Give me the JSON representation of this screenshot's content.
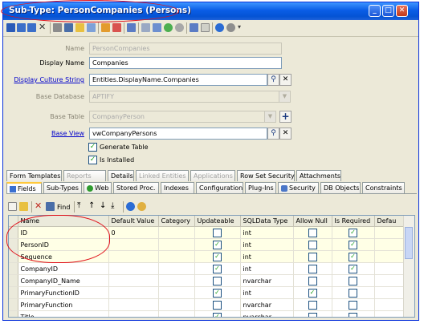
{
  "window": {
    "title": "Sub-Type: PersonCompanies (Persons)"
  },
  "colors": {
    "titlebar": "#0a5de6",
    "highlight_annotation": "#e0101a",
    "link": "#0000cc"
  },
  "form": {
    "name": {
      "label": "Name",
      "value": "PersonCompanies"
    },
    "display_name": {
      "label": "Display Name",
      "value": "Companies"
    },
    "display_culture_string": {
      "label": "Display Culture String",
      "value": "Entities.DisplayName.Companies"
    },
    "base_database": {
      "label": "Base Database",
      "value": "APTIFY"
    },
    "base_table": {
      "label": "Base Table",
      "value": "CompanyPerson"
    },
    "base_view": {
      "label": "Base View",
      "value": "vwCompanyPersons"
    },
    "generate_table": {
      "label": "Generate Table",
      "checked": true
    },
    "is_installed": {
      "label": "Is Installed",
      "checked": true
    }
  },
  "tabs_row1": [
    "Form Templates",
    "Reports",
    "Details",
    "Linked Entities",
    "Applications",
    "Row Set Security",
    "Attachments"
  ],
  "tabs_row2": [
    "Fields",
    "Sub-Types",
    "Web",
    "Stored Proc.",
    "Indexes",
    "Configuration",
    "Plug-Ins",
    "Security",
    "DB Objects",
    "Constraints"
  ],
  "grid_toolbar": {
    "find_label": "Find"
  },
  "grid": {
    "columns": [
      "Name",
      "Default Value",
      "Category",
      "Updateable",
      "SQLData Type",
      "Allow Null",
      "Is Required",
      "Defau"
    ],
    "rows": [
      {
        "name": "ID",
        "default": "0",
        "category": "",
        "updateable": false,
        "sqltype": "int",
        "allow_null": false,
        "required": true
      },
      {
        "name": "PersonID",
        "default": "",
        "category": "",
        "updateable": true,
        "sqltype": "int",
        "allow_null": false,
        "required": true
      },
      {
        "name": "Sequence",
        "default": "",
        "category": "",
        "updateable": true,
        "sqltype": "int",
        "allow_null": false,
        "required": true
      },
      {
        "name": "CompanyID",
        "default": "",
        "category": "",
        "updateable": true,
        "sqltype": "int",
        "allow_null": false,
        "required": true
      },
      {
        "name": "CompanyID_Name",
        "default": "",
        "category": "",
        "updateable": false,
        "sqltype": "nvarchar",
        "allow_null": false,
        "required": false
      },
      {
        "name": "PrimaryFunctionID",
        "default": "",
        "category": "",
        "updateable": true,
        "sqltype": "int",
        "allow_null": true,
        "required": false
      },
      {
        "name": "PrimaryFunction",
        "default": "",
        "category": "",
        "updateable": false,
        "sqltype": "nvarchar",
        "allow_null": false,
        "required": false
      },
      {
        "name": "Title",
        "default": "",
        "category": "",
        "updateable": true,
        "sqltype": "nvarchar",
        "allow_null": false,
        "required": false
      }
    ]
  }
}
